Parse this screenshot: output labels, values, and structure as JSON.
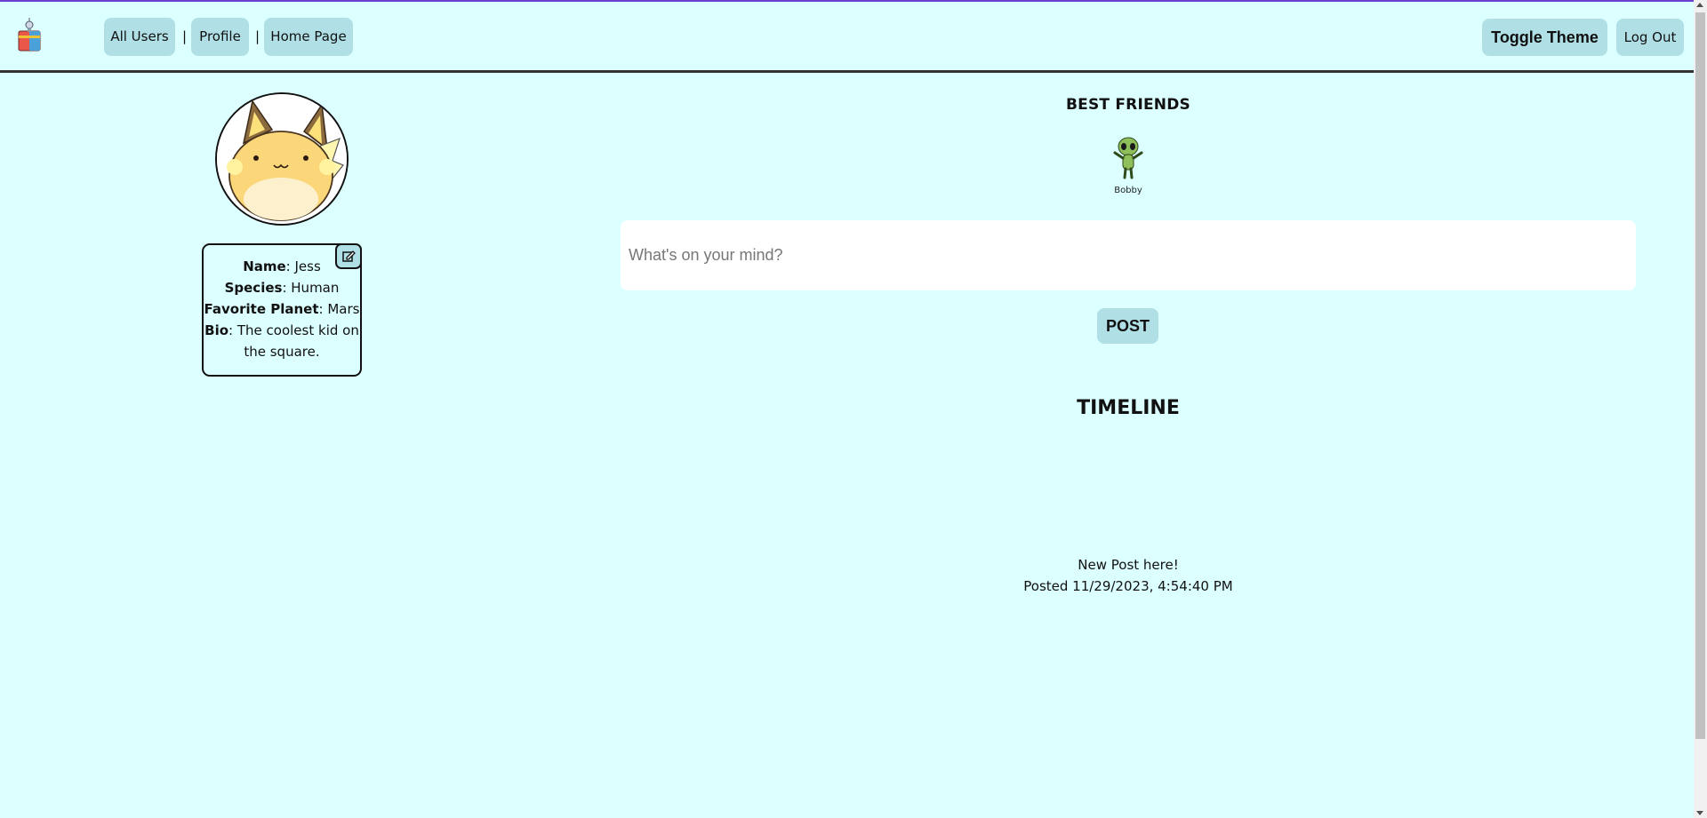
{
  "nav": {
    "items": [
      "All Users",
      "Profile",
      "Home Page"
    ],
    "separator": "|",
    "toggle_theme": "Toggle Theme",
    "logout": "Log Out"
  },
  "profile": {
    "name_label": "Name",
    "name": "Jess",
    "species_label": "Species",
    "species": "Human",
    "planet_label": "Favorite Planet",
    "planet": "Mars",
    "bio_label": "Bio",
    "bio": "The coolest kid on the square."
  },
  "best_friends": {
    "title": "BEST FRIENDS",
    "friends": [
      {
        "name": "Bobby"
      }
    ]
  },
  "composer": {
    "placeholder": "What's on your mind?",
    "post_label": "POST"
  },
  "timeline": {
    "title": "TIMELINE",
    "posts": [
      {
        "text": "New Post here!",
        "posted": "Posted 11/29/2023, 4:54:40 PM"
      }
    ]
  },
  "colors": {
    "background": "#dcffff",
    "button": "#b0e0e6",
    "accent": "#6a3fd1"
  }
}
